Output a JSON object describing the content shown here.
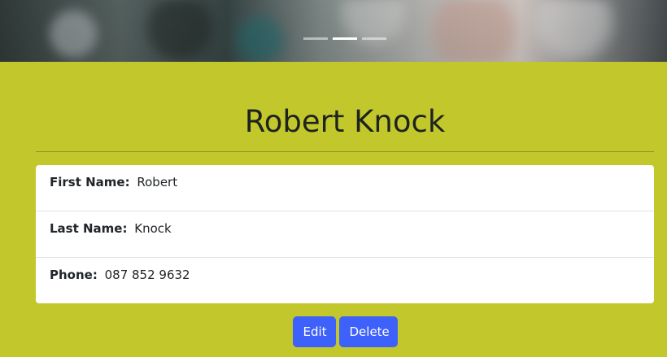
{
  "carousel": {
    "slides": 3,
    "active_slide": 2
  },
  "profile": {
    "title": "Robert Knock",
    "fields": [
      {
        "label": "First Name:",
        "value": "Robert"
      },
      {
        "label": "Last Name:",
        "value": "Knock"
      },
      {
        "label": "Phone:",
        "value": "087 852 9632"
      }
    ]
  },
  "actions": {
    "edit_label": "Edit",
    "delete_label": "Delete"
  },
  "colors": {
    "background": "#c2c82c",
    "card": "#ffffff",
    "button": "#3f61fb",
    "text": "#212529"
  }
}
